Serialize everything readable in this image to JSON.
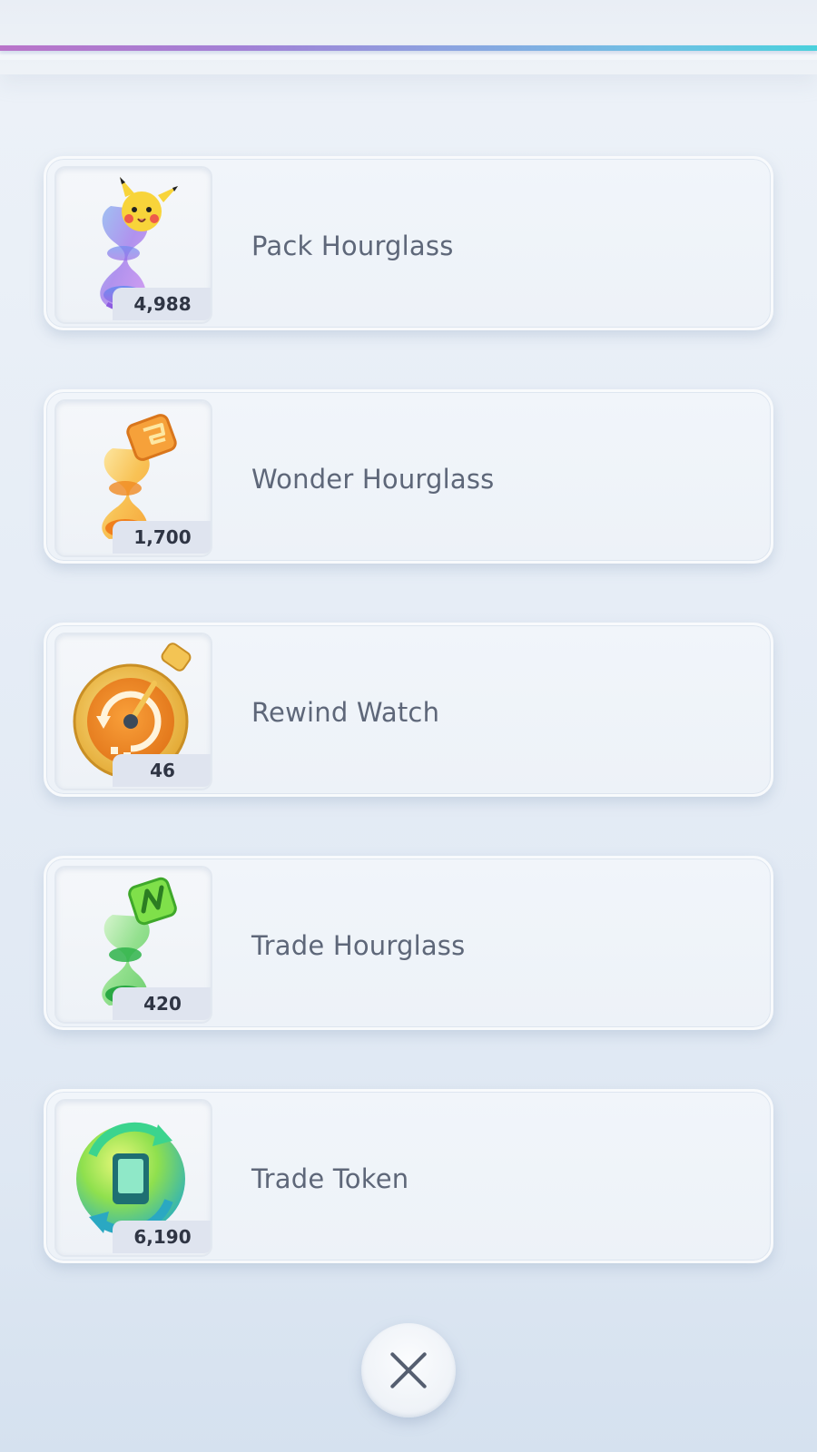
{
  "items": [
    {
      "name": "Pack Hourglass",
      "count": "4,988",
      "icon": "pack-hourglass-icon"
    },
    {
      "name": "Wonder Hourglass",
      "count": "1,700",
      "icon": "wonder-hourglass-icon"
    },
    {
      "name": "Rewind Watch",
      "count": "46",
      "icon": "rewind-watch-icon"
    },
    {
      "name": "Trade Hourglass",
      "count": "420",
      "icon": "trade-hourglass-icon"
    },
    {
      "name": "Trade Token",
      "count": "6,190",
      "icon": "trade-token-icon"
    }
  ],
  "close_button": {
    "icon": "close-icon"
  },
  "colors": {
    "accent_gradient": [
      "#b974c9",
      "#8ba3e0",
      "#4ad0dc"
    ],
    "text": "#5e6779",
    "badge_text": "#2f3544"
  }
}
